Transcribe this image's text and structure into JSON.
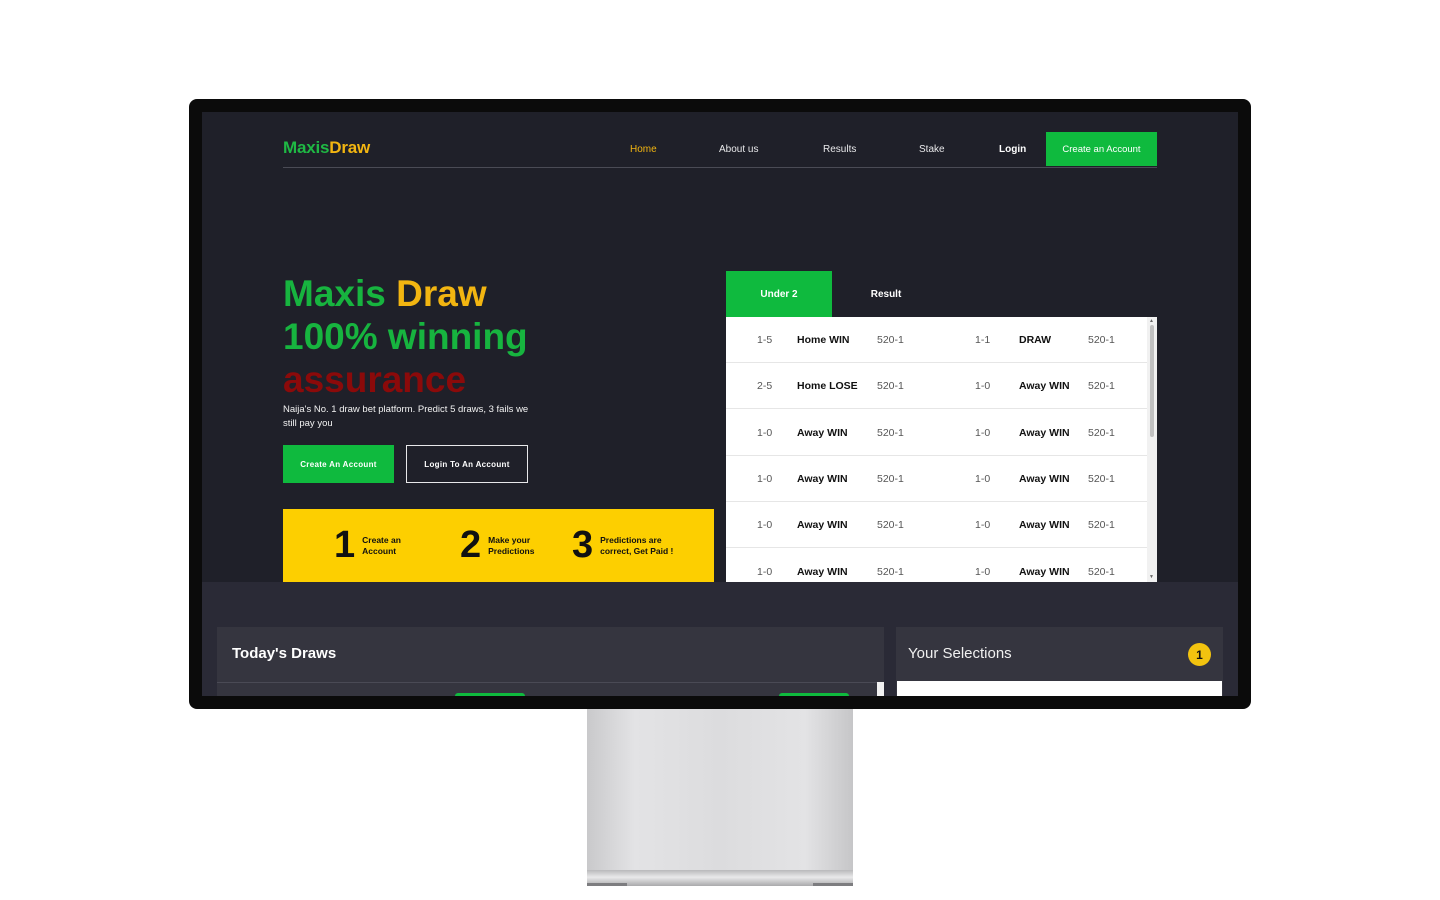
{
  "brand": {
    "part1": "Maxis",
    "part2": "Draw"
  },
  "nav": {
    "links": [
      "Home",
      "About us",
      "Results",
      "Stake",
      "Login"
    ],
    "cta": "Create an Account"
  },
  "hero": {
    "line1_part1": "Maxis",
    "line1_part2": "Draw",
    "line2": "100% winning",
    "line3": "assurance",
    "subtitle": "Naija's No. 1 draw bet platform. Predict 5 draws, 3 fails we still pay you",
    "primary_button": "Create An Account",
    "secondary_button": "Login To An Account"
  },
  "steps": [
    {
      "num": "1",
      "text": "Create an Account"
    },
    {
      "num": "2",
      "text": "Make your Predictions"
    },
    {
      "num": "3",
      "text": "Predictions are correct, Get Paid !"
    }
  ],
  "tabs": {
    "active": "Under 2",
    "other": "Result"
  },
  "table_rows": [
    [
      "1-5",
      "Home WIN",
      "520-1",
      "1-1",
      "DRAW",
      "520-1"
    ],
    [
      "2-5",
      "Home LOSE",
      "520-1",
      "1-0",
      "Away WIN",
      "520-1"
    ],
    [
      "1-0",
      "Away WIN",
      "520-1",
      "1-0",
      "Away WIN",
      "520-1"
    ],
    [
      "1-0",
      "Away WIN",
      "520-1",
      "1-0",
      "Away WIN",
      "520-1"
    ],
    [
      "1-0",
      "Away WIN",
      "520-1",
      "1-0",
      "Away WIN",
      "520-1"
    ],
    [
      "1-0",
      "Away WIN",
      "520-1",
      "1-0",
      "Away WIN",
      "520-1"
    ]
  ],
  "todays_draws": {
    "title": "Today's Draws"
  },
  "selections": {
    "title": "Your Selections",
    "count": "1"
  },
  "colors": {
    "green": "#0fba3e",
    "yellow": "#fdcf00",
    "dark_red": "#8b0a0a",
    "bg": "#1f2029"
  }
}
